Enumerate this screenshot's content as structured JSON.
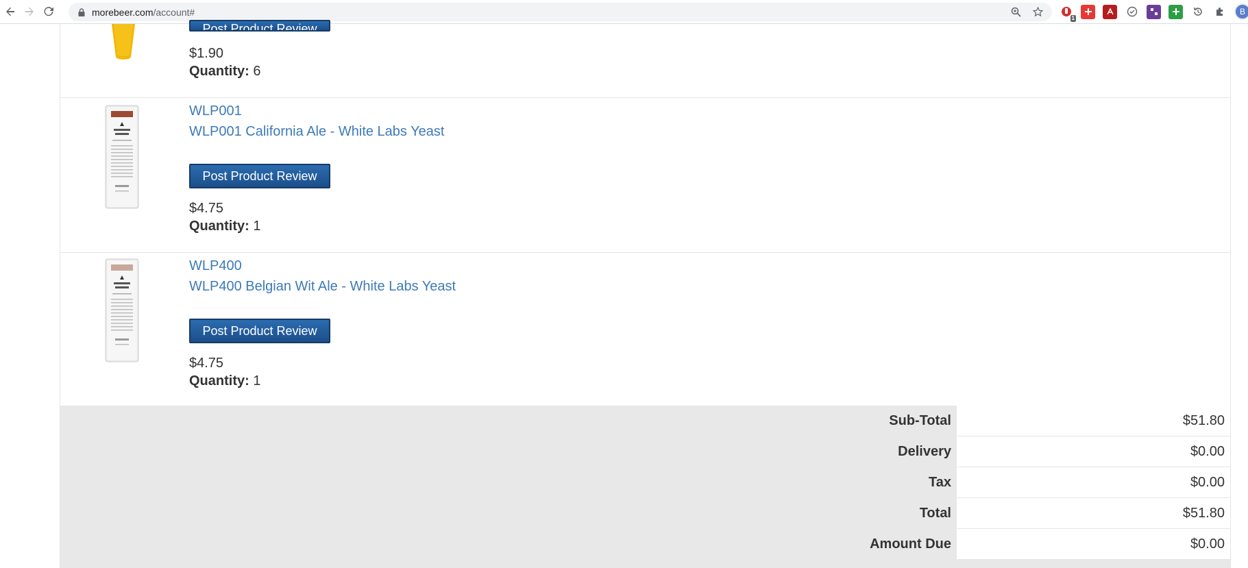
{
  "browser": {
    "url_host": "morebeer.com",
    "url_path": "/account#",
    "profile_initial": "B",
    "ext_badge": "1"
  },
  "items": [
    {
      "price": "$1.90",
      "qty_label": "Quantity:",
      "qty": "6",
      "review_label": "Post Product Review"
    },
    {
      "sku": "WLP001",
      "name": "WLP001 California Ale - White Labs Yeast",
      "review_label": "Post Product Review",
      "price": "$4.75",
      "qty_label": "Quantity:",
      "qty": "1"
    },
    {
      "sku": "WLP400",
      "name": "WLP400 Belgian Wit Ale - White Labs Yeast",
      "review_label": "Post Product Review",
      "price": "$4.75",
      "qty_label": "Quantity:",
      "qty": "1"
    }
  ],
  "totals": [
    {
      "label": "Sub-Total",
      "value": "$51.80"
    },
    {
      "label": "Delivery",
      "value": "$0.00"
    },
    {
      "label": "Tax",
      "value": "$0.00"
    },
    {
      "label": "Total",
      "value": "$51.80"
    },
    {
      "label": "Amount Due",
      "value": "$0.00"
    }
  ],
  "colors": {
    "link": "#3d7ab8",
    "button": "#1c4f8a",
    "totals_bg": "#e8e8e8"
  }
}
